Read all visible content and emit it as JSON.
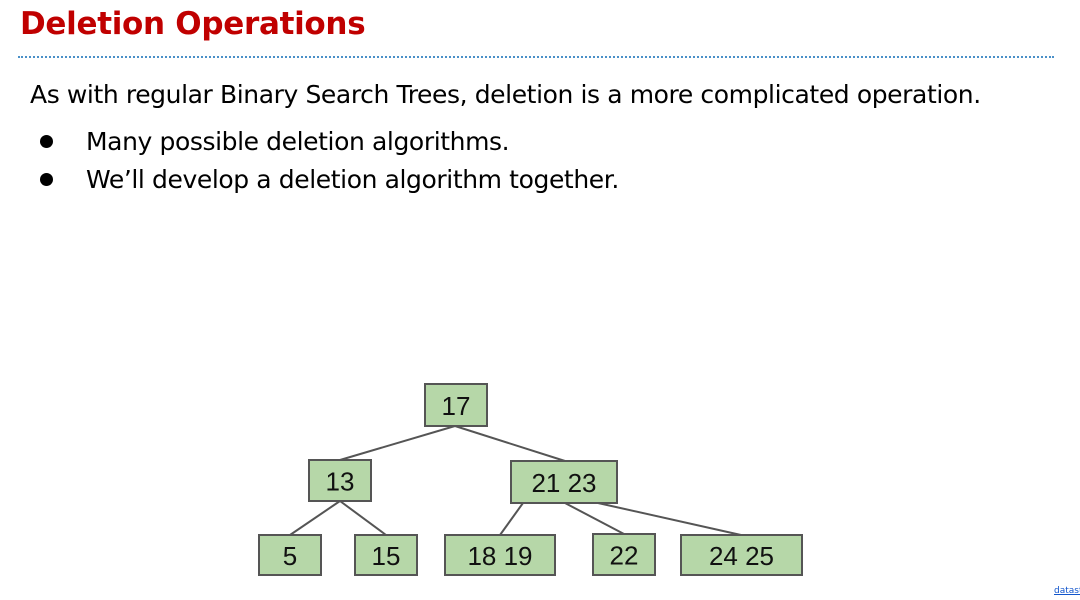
{
  "slide": {
    "title": "Deletion Operations",
    "intro": "As with regular Binary Search Trees, deletion is a more complicated operation.",
    "bullets": [
      "Many possible deletion algorithms.",
      "We’ll develop a deletion algorithm together."
    ],
    "footer_link": "datast"
  },
  "tree": {
    "nodes": [
      {
        "id": "n17",
        "label": "17"
      },
      {
        "id": "n13",
        "label": "13"
      },
      {
        "id": "n2123",
        "label": "21  23"
      },
      {
        "id": "n5",
        "label": "5"
      },
      {
        "id": "n15",
        "label": "15"
      },
      {
        "id": "n1819",
        "label": "18  19"
      },
      {
        "id": "n22",
        "label": "22"
      },
      {
        "id": "n2425",
        "label": "24  25"
      }
    ],
    "edges": [
      [
        "n17",
        "n13"
      ],
      [
        "n17",
        "n2123"
      ],
      [
        "n13",
        "n5"
      ],
      [
        "n13",
        "n15"
      ],
      [
        "n2123",
        "n1819"
      ],
      [
        "n2123",
        "n22"
      ],
      [
        "n2123",
        "n2425"
      ]
    ],
    "colors": {
      "node_fill": "#b6d7a8",
      "node_border": "#555555",
      "title": "#c00000",
      "rule": "#4a90c8"
    }
  }
}
